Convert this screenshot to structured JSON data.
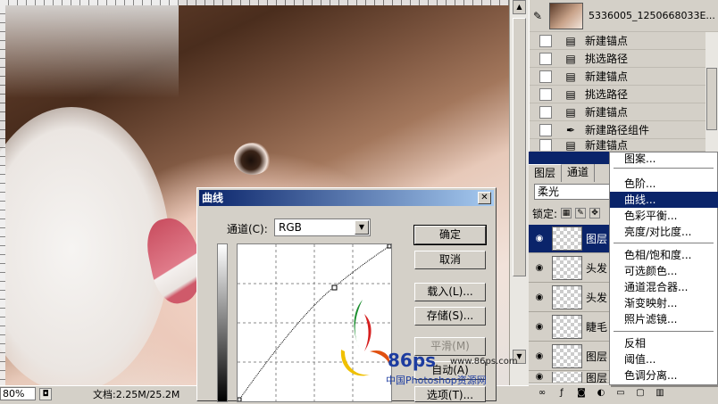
{
  "canvas": {
    "zoom": "80%",
    "doc_info": "文档:2.25M/25.2M"
  },
  "history": {
    "snapshot_label": "5336005_1250668033E...",
    "items": [
      {
        "label": "新建锚点"
      },
      {
        "label": "挑选路径"
      },
      {
        "label": "新建锚点"
      },
      {
        "label": "挑选路径"
      },
      {
        "label": "新建锚点"
      },
      {
        "label": "新建路径组件"
      },
      {
        "label": "新建锚点"
      }
    ]
  },
  "layers": {
    "tabs": [
      {
        "label": "图层"
      },
      {
        "label": "通道"
      }
    ],
    "blend_mode": "柔光",
    "lock_label": "锁定:",
    "rows": [
      {
        "label": "图层",
        "selected": true
      },
      {
        "label": "头发"
      },
      {
        "label": "头发"
      },
      {
        "label": "睫毛"
      },
      {
        "label": "图层"
      },
      {
        "label": "图层"
      }
    ]
  },
  "adjust_menu": {
    "items": [
      {
        "label": "图案..."
      },
      {
        "label": "色阶..."
      },
      {
        "label": "曲线...",
        "highlight": true
      },
      {
        "label": "色彩平衡..."
      },
      {
        "label": "亮度/对比度..."
      },
      {
        "label": "色相/饱和度..."
      },
      {
        "label": "可选颜色..."
      },
      {
        "label": "通道混合器..."
      },
      {
        "label": "渐变映射..."
      },
      {
        "label": "照片滤镜..."
      },
      {
        "label": "反相"
      },
      {
        "label": "阈值..."
      },
      {
        "label": "色调分离..."
      }
    ]
  },
  "curves_dialog": {
    "title": "曲线",
    "channel_label": "通道(C):",
    "channel_value": "RGB",
    "buttons": {
      "ok": "确定",
      "cancel": "取消",
      "load": "载入(L)...",
      "save": "存储(S)...",
      "smooth": "平滑(M)",
      "auto": "自动(A)",
      "options": "选项(T)..."
    }
  },
  "watermark": {
    "brand": "86ps",
    "url": "www.86ps.com",
    "site_name": "中国Photoshop资源网"
  },
  "colors": {
    "selection": "#0a246a",
    "panel_bg": "#d4d0c8"
  }
}
